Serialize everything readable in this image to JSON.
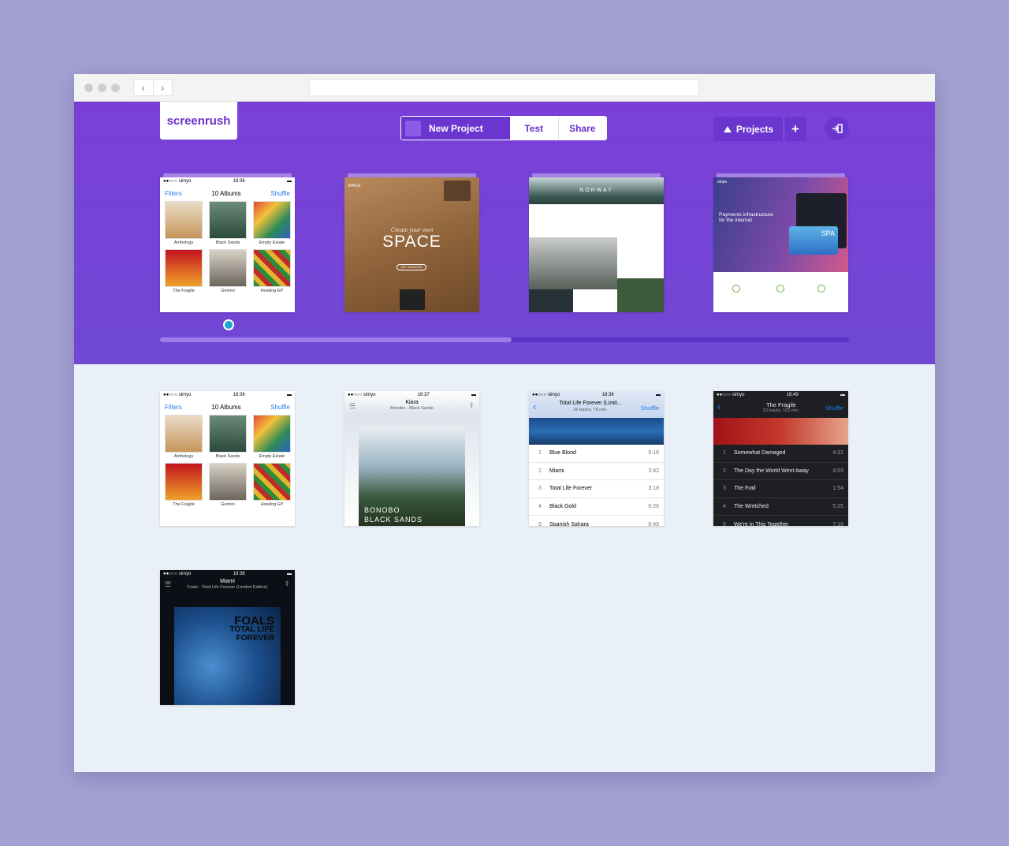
{
  "app": {
    "logo": "screenrush",
    "toolbar": {
      "new_project": "New Project",
      "test": "Test",
      "share": "Share",
      "projects": "Projects",
      "add": "+"
    },
    "carousel_progress_percent": 51
  },
  "screens": {
    "albums": {
      "carrier": "●●○○○ simyo",
      "time": "18:36",
      "left": "Filters",
      "title": "10 Albums",
      "right": "Shuffle",
      "albums": [
        "Anthology",
        "Black Sands",
        "Empty Estate",
        "The Fragile",
        "Gemini",
        "Howling EP"
      ]
    },
    "space": {
      "small": "SPACE",
      "tag": "Create your own",
      "title": "SPACE",
      "cta": "GET STARTED"
    },
    "norway": {
      "title": "NORWAY"
    },
    "stripe": {
      "brand": "stripe",
      "headline": "Payments infrastructure for the internet",
      "card_text": "SPA"
    },
    "kiara": {
      "carrier": "●●○○○ simyo",
      "time": "18:37",
      "title": "Kiara",
      "subtitle": "Bonobo - Black Sands",
      "cover_artist": "BONOBO",
      "cover_title": "BLACK SANDS"
    },
    "foals_list": {
      "carrier": "●●○○○ simyo",
      "time": "18:36",
      "title": "Total Life Forever (Limit...",
      "subtitle": "26 tracks, 76 min.",
      "right": "Shuffle",
      "tracks": [
        {
          "n": "1",
          "name": "Blue Blood",
          "dur": "5:16"
        },
        {
          "n": "2",
          "name": "Miami",
          "dur": "3:42"
        },
        {
          "n": "3",
          "name": "Total Life Forever",
          "dur": "3:18"
        },
        {
          "n": "4",
          "name": "Black Gold",
          "dur": "6:26"
        },
        {
          "n": "5",
          "name": "Spanish Sahara",
          "dur": "6:49"
        }
      ]
    },
    "fragile": {
      "carrier": "●●○○○ simyo",
      "time": "18:49",
      "title": "The Fragile",
      "subtitle": "23 tracks, 102 min.",
      "right": "Shuffle",
      "tracks": [
        {
          "n": "1",
          "name": "Somewhat Damaged",
          "dur": "4:31"
        },
        {
          "n": "2",
          "name": "The Day the World Went Away",
          "dur": "4:03"
        },
        {
          "n": "3",
          "name": "The Frail",
          "dur": "1:54"
        },
        {
          "n": "4",
          "name": "The Wretched",
          "dur": "5:25"
        },
        {
          "n": "5",
          "name": "We're in This Together",
          "dur": "7:16"
        }
      ]
    },
    "miami": {
      "carrier": "●●○○○ simyo",
      "time": "18:38",
      "title": "Miami",
      "subtitle": "Foals - Total Life Forever (Limited Edition)",
      "cover_line1": "FOALS",
      "cover_line2": "TOTAL LIFE",
      "cover_line3": "FOREVER"
    }
  },
  "colors": {
    "brand": "#7b3fd8",
    "accent": "#1ba7c9",
    "ios_blue": "#1f7cf0"
  }
}
